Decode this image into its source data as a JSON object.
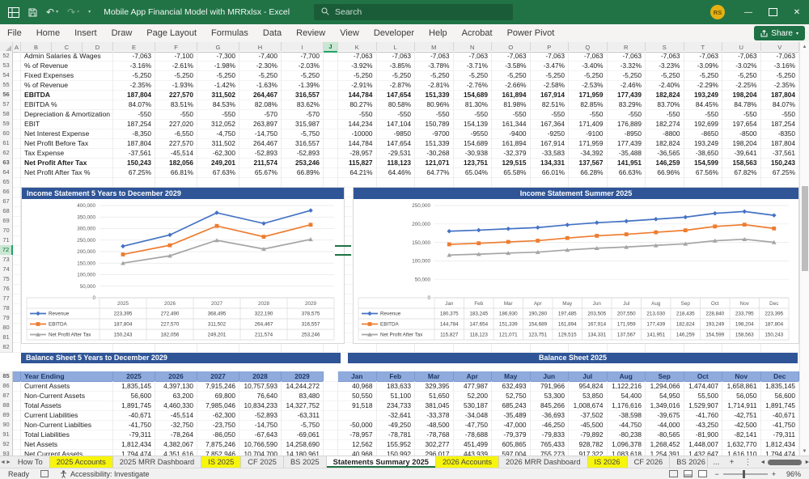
{
  "title_bar": {
    "title": "Mobile App Financial Model with MRRxlsx  -  Excel",
    "search_placeholder": "Search",
    "avatar_initials": "RS"
  },
  "ribbon": {
    "tabs": [
      "File",
      "Home",
      "Insert",
      "Draw",
      "Page Layout",
      "Formulas",
      "Data",
      "Review",
      "View",
      "Developer",
      "Help",
      "Acrobat",
      "Power Pivot"
    ],
    "share_label": "Share"
  },
  "sheet": {
    "columns": [
      "A",
      "B",
      "C",
      "D",
      "E",
      "F",
      "G",
      "H",
      "I",
      "J",
      "K",
      "L",
      "M",
      "N",
      "O",
      "P",
      "Q",
      "R",
      "S",
      "T",
      "U",
      "V"
    ],
    "selected_column": "J",
    "selected_row": 72,
    "chart_strip_rows": [
      65,
      66,
      67,
      68,
      69,
      70,
      71,
      72,
      73,
      74,
      75,
      76,
      77,
      78,
      79,
      80,
      81,
      82
    ],
    "income_statement": {
      "rows": [
        {
          "row": 52,
          "label": "Admin Salaries & Wages",
          "bold": false,
          "yearly": [
            "-7,063",
            "-7,100",
            "-7,300",
            "-7,400",
            "-7,700"
          ],
          "monthly": [
            "-7,063",
            "-7,063",
            "-7,063",
            "-7,063",
            "-7,063",
            "-7,063",
            "-7,063",
            "-7,063",
            "-7,063",
            "-7,063",
            "-7,063",
            "-7,063"
          ]
        },
        {
          "row": 53,
          "label": "% of Revenue",
          "bold": false,
          "yearly": [
            "-3.16%",
            "-2.61%",
            "-1.98%",
            "-2.30%",
            "-2.03%"
          ],
          "monthly": [
            "-3.92%",
            "-3.85%",
            "-3.78%",
            "-3.71%",
            "-3.58%",
            "-3.47%",
            "-3.40%",
            "-3.32%",
            "-3.23%",
            "-3.09%",
            "-3.02%",
            "-3.16%"
          ]
        },
        {
          "row": 54,
          "label": "Fixed Expenses",
          "bold": false,
          "yearly": [
            "-5,250",
            "-5,250",
            "-5,250",
            "-5,250",
            "-5,250"
          ],
          "monthly": [
            "-5,250",
            "-5,250",
            "-5,250",
            "-5,250",
            "-5,250",
            "-5,250",
            "-5,250",
            "-5,250",
            "-5,250",
            "-5,250",
            "-5,250",
            "-5,250"
          ]
        },
        {
          "row": 55,
          "label": "% of Revenue",
          "bold": false,
          "yearly": [
            "-2.35%",
            "-1.93%",
            "-1.42%",
            "-1.63%",
            "-1.39%"
          ],
          "monthly": [
            "-2.91%",
            "-2.87%",
            "-2.81%",
            "-2.76%",
            "-2.66%",
            "-2.58%",
            "-2.53%",
            "-2.46%",
            "-2.40%",
            "-2.29%",
            "-2.25%",
            "-2.35%"
          ]
        },
        {
          "row": 56,
          "label": "EBITDA",
          "bold": true,
          "yearly": [
            "187,804",
            "227,570",
            "311,502",
            "264,467",
            "316,557"
          ],
          "monthly": [
            "144,784",
            "147,654",
            "151,339",
            "154,689",
            "161,894",
            "167,914",
            "171,959",
            "177,439",
            "182,824",
            "193,249",
            "198,204",
            "187,804"
          ]
        },
        {
          "row": 57,
          "label": "EBITDA %",
          "bold": false,
          "yearly": [
            "84.07%",
            "83.51%",
            "84.53%",
            "82.08%",
            "83.62%"
          ],
          "monthly": [
            "80.27%",
            "80.58%",
            "80.96%",
            "81.30%",
            "81.98%",
            "82.51%",
            "82.85%",
            "83.29%",
            "83.70%",
            "84.45%",
            "84.78%",
            "84.07%"
          ]
        },
        {
          "row": 58,
          "label": "Depreciation & Amortization",
          "bold": false,
          "yearly": [
            "-550",
            "-550",
            "-550",
            "-570",
            "-570"
          ],
          "monthly": [
            "-550",
            "-550",
            "-550",
            "-550",
            "-550",
            "-550",
            "-550",
            "-550",
            "-550",
            "-550",
            "-550",
            "-550"
          ]
        },
        {
          "row": 59,
          "label": "EBIT",
          "bold": false,
          "yearly": [
            "187,254",
            "227,020",
            "312,052",
            "263,897",
            "315,987"
          ],
          "monthly": [
            "144,234",
            "147,104",
            "150,789",
            "154,139",
            "161,344",
            "167,364",
            "171,409",
            "176,889",
            "182,274",
            "192,699",
            "197,654",
            "187,254"
          ]
        },
        {
          "row": 60,
          "label": "Net Interest Expense",
          "bold": false,
          "yearly": [
            "-8,350",
            "-6,550",
            "-4,750",
            "-14,750",
            "-5,750"
          ],
          "monthly": [
            "-10000",
            "-9850",
            "-9700",
            "-9550",
            "-9400",
            "-9250",
            "-9100",
            "-8950",
            "-8800",
            "-8650",
            "-8500",
            "-8350"
          ]
        },
        {
          "row": 61,
          "label": "Net Profit Before Tax",
          "bold": false,
          "yearly": [
            "187,804",
            "227,570",
            "311,502",
            "264,467",
            "316,557"
          ],
          "monthly": [
            "144,784",
            "147,654",
            "151,339",
            "154,689",
            "161,894",
            "167,914",
            "171,959",
            "177,439",
            "182,824",
            "193,249",
            "198,204",
            "187,804"
          ]
        },
        {
          "row": 62,
          "label": "Tax Expense",
          "bold": false,
          "yearly": [
            "-37,561",
            "-45,514",
            "-62,300",
            "-52,893",
            "-52,893"
          ],
          "monthly": [
            "-28,957",
            "-29,531",
            "-30,268",
            "-30,938",
            "-32,379",
            "-33,583",
            "-34,392",
            "-35,488",
            "-36,565",
            "-38,650",
            "-39,641",
            "-37,561"
          ]
        },
        {
          "row": 63,
          "label": "Net Profit After Tax",
          "bold": true,
          "yearly": [
            "150,243",
            "182,056",
            "249,201",
            "211,574",
            "253,246"
          ],
          "monthly": [
            "115,827",
            "118,123",
            "121,071",
            "123,751",
            "129,515",
            "134,331",
            "137,567",
            "141,951",
            "146,259",
            "154,599",
            "158,563",
            "150,243"
          ]
        },
        {
          "row": 64,
          "label": "Net Profit After Tax %",
          "bold": false,
          "yearly": [
            "67.25%",
            "66.81%",
            "67.63%",
            "65.67%",
            "66.89%"
          ],
          "monthly": [
            "64.21%",
            "64.46%",
            "64.77%",
            "65.04%",
            "65.58%",
            "66.01%",
            "66.28%",
            "66.63%",
            "66.96%",
            "67.56%",
            "67.82%",
            "67.25%"
          ]
        }
      ]
    },
    "balance_sheet": {
      "left_header": "Balance Sheet 5 Years to December 2029",
      "right_header": "Balance Sheet 2025",
      "year_header": {
        "label": "Year Ending",
        "years": [
          "2025",
          "2026",
          "2027",
          "2028",
          "2029"
        ],
        "months": [
          "Jan",
          "Feb",
          "Mar",
          "Apr",
          "May",
          "Jun",
          "Jul",
          "Aug",
          "Sep",
          "Oct",
          "Nov",
          "Dec"
        ]
      },
      "rows": [
        {
          "row": 86,
          "label": "Current Assets",
          "yearly": [
            "1,835,145",
            "4,397,130",
            "7,915,246",
            "10,757,593",
            "14,244,272"
          ],
          "monthly": [
            "40,968",
            "183,633",
            "329,395",
            "477,987",
            "632,493",
            "791,966",
            "954,824",
            "1,122,216",
            "1,294,066",
            "1,474,407",
            "1,658,861",
            "1,835,145"
          ]
        },
        {
          "row": 87,
          "label": "Non-Current Assets",
          "yearly": [
            "56,600",
            "63,200",
            "69,800",
            "76,640",
            "83,480"
          ],
          "monthly": [
            "50,550",
            "51,100",
            "51,650",
            "52,200",
            "52,750",
            "53,300",
            "53,850",
            "54,400",
            "54,950",
            "55,500",
            "56,050",
            "56,600"
          ]
        },
        {
          "row": 88,
          "label": "Total Assets",
          "yearly": [
            "1,891,745",
            "4,460,330",
            "7,985,046",
            "10,834,233",
            "14,327,752"
          ],
          "monthly": [
            "91,518",
            "234,733",
            "381,045",
            "530,187",
            "685,243",
            "845,266",
            "1,008,674",
            "1,176,616",
            "1,349,016",
            "1,529,907",
            "1,714,911",
            "1,891,745"
          ]
        },
        {
          "row": 89,
          "label": "Current Liabilities",
          "yearly": [
            "-40,671",
            "-45,514",
            "-62,300",
            "-52,893",
            "-63,311"
          ],
          "monthly": [
            "",
            "-32,641",
            "-33,378",
            "-34,048",
            "-35,489",
            "-36,693",
            "-37,502",
            "-38,598",
            "-39,675",
            "-41,760",
            "-42,751",
            "-40,671"
          ]
        },
        {
          "row": 90,
          "label": "Non-Current Liabilties",
          "yearly": [
            "-41,750",
            "-32,750",
            "-23,750",
            "-14,750",
            "-5,750"
          ],
          "monthly": [
            "-50,000",
            "-49,250",
            "-48,500",
            "-47,750",
            "-47,000",
            "-46,250",
            "-45,500",
            "-44,750",
            "-44,000",
            "-43,250",
            "-42,500",
            "-41,750"
          ]
        },
        {
          "row": 91,
          "label": "Total Liabilities",
          "yearly": [
            "-79,311",
            "-78,264",
            "-86,050",
            "-67,643",
            "-69,061"
          ],
          "monthly": [
            "-78,957",
            "-78,781",
            "-78,768",
            "-78,688",
            "-79,379",
            "-79,833",
            "-79,892",
            "-80,238",
            "-80,565",
            "-81,900",
            "-82,141",
            "-79,311"
          ]
        },
        {
          "row": 92,
          "label": "Net Assets",
          "yearly": [
            "1,812,434",
            "4,382,067",
            "7,875,246",
            "10,766,590",
            "14,258,690"
          ],
          "monthly": [
            "12,562",
            "155,952",
            "302,277",
            "451,499",
            "605,865",
            "765,433",
            "928,782",
            "1,096,378",
            "1,268,452",
            "1,448,007",
            "1,632,770",
            "1,812,434"
          ]
        }
      ],
      "partial_row": {
        "row": 93,
        "label": "Net Current Assets",
        "yearly": [
          "1,794,474",
          "4,351,616",
          "7,852,946",
          "10,704,700",
          "14,180,961"
        ],
        "monthly": [
          "40,968",
          "150,992",
          "296,017",
          "443,939",
          "597,004",
          "755,273",
          "917,322",
          "1,083,618",
          "1,254,391",
          "1,432,647",
          "1,616,110",
          "1,794,474"
        ]
      }
    }
  },
  "chart_data": [
    {
      "type": "line",
      "title": "Income Statement 5 Years to December 2029",
      "categories": [
        "2025",
        "2026",
        "2027",
        "2028",
        "2029"
      ],
      "ylim": [
        0,
        400000
      ],
      "ytick": 50000,
      "grid": true,
      "legend_position": "table-bottom",
      "series": [
        {
          "name": "Revenue",
          "color": "#4472C4",
          "values": [
            223395,
            272490,
            368495,
            322190,
            378575
          ]
        },
        {
          "name": "EBITDA",
          "color": "#ED7D31",
          "values": [
            187804,
            227570,
            311502,
            264467,
            316557
          ]
        },
        {
          "name": "Net Profit After Tax",
          "color": "#A5A5A5",
          "values": [
            150243,
            182056,
            249201,
            211574,
            253246
          ]
        }
      ]
    },
    {
      "type": "line",
      "title": "Income Statement Summer 2025",
      "categories": [
        "Jan",
        "Feb",
        "Mar",
        "Apr",
        "May",
        "Jun",
        "Jul",
        "Aug",
        "Sep",
        "Oct",
        "Nov",
        "Dec"
      ],
      "ylim": [
        0,
        250000
      ],
      "ytick": 50000,
      "grid": true,
      "legend_position": "table-bottom",
      "series": [
        {
          "name": "Revenue",
          "color": "#4472C4",
          "values": [
            180375,
            183245,
            186930,
            190280,
            197485,
            203505,
            207550,
            213030,
            218435,
            228840,
            233795,
            223395
          ]
        },
        {
          "name": "EBITDA",
          "color": "#ED7D31",
          "values": [
            144784,
            147654,
            151339,
            154689,
            161894,
            167914,
            171959,
            177439,
            182824,
            193249,
            198204,
            187804
          ]
        },
        {
          "name": "Net Profit After Tax",
          "color": "#A5A5A5",
          "values": [
            115827,
            118123,
            121071,
            123751,
            129515,
            134331,
            137567,
            141951,
            146259,
            154599,
            158563,
            150243
          ]
        }
      ]
    }
  ],
  "tab_bar": {
    "tabs": [
      {
        "label": "How To",
        "style": "plain"
      },
      {
        "label": "2025 Accounts",
        "style": "yellow"
      },
      {
        "label": "2025 MRR Dashboard",
        "style": "plain"
      },
      {
        "label": "IS 2025",
        "style": "yellow"
      },
      {
        "label": "CF 2025",
        "style": "plain"
      },
      {
        "label": "BS 2025",
        "style": "plain"
      },
      {
        "label": "Statements Summary 2025",
        "style": "active"
      },
      {
        "label": "2026 Accounts",
        "style": "yellow"
      },
      {
        "label": "2026 MRR Dashboard",
        "style": "plain"
      },
      {
        "label": "IS 2026",
        "style": "yellow"
      },
      {
        "label": "CF 2026",
        "style": "plain"
      },
      {
        "label": "BS 2026",
        "style": "clipped"
      }
    ],
    "more_label": "...",
    "add_label": "+"
  },
  "status_bar": {
    "ready_label": "Ready",
    "accessibility_label": "Accessibility: Investigate",
    "zoom_level": "96%"
  },
  "colors": {
    "titlebar_green": "#217346",
    "chart_header_blue": "#2F5597",
    "year_header_blue": "#8FAADC",
    "tab_highlight_yellow": "#F7F50A",
    "series_revenue": "#4472C4",
    "series_ebitda": "#ED7D31",
    "series_npat": "#A5A5A5"
  }
}
